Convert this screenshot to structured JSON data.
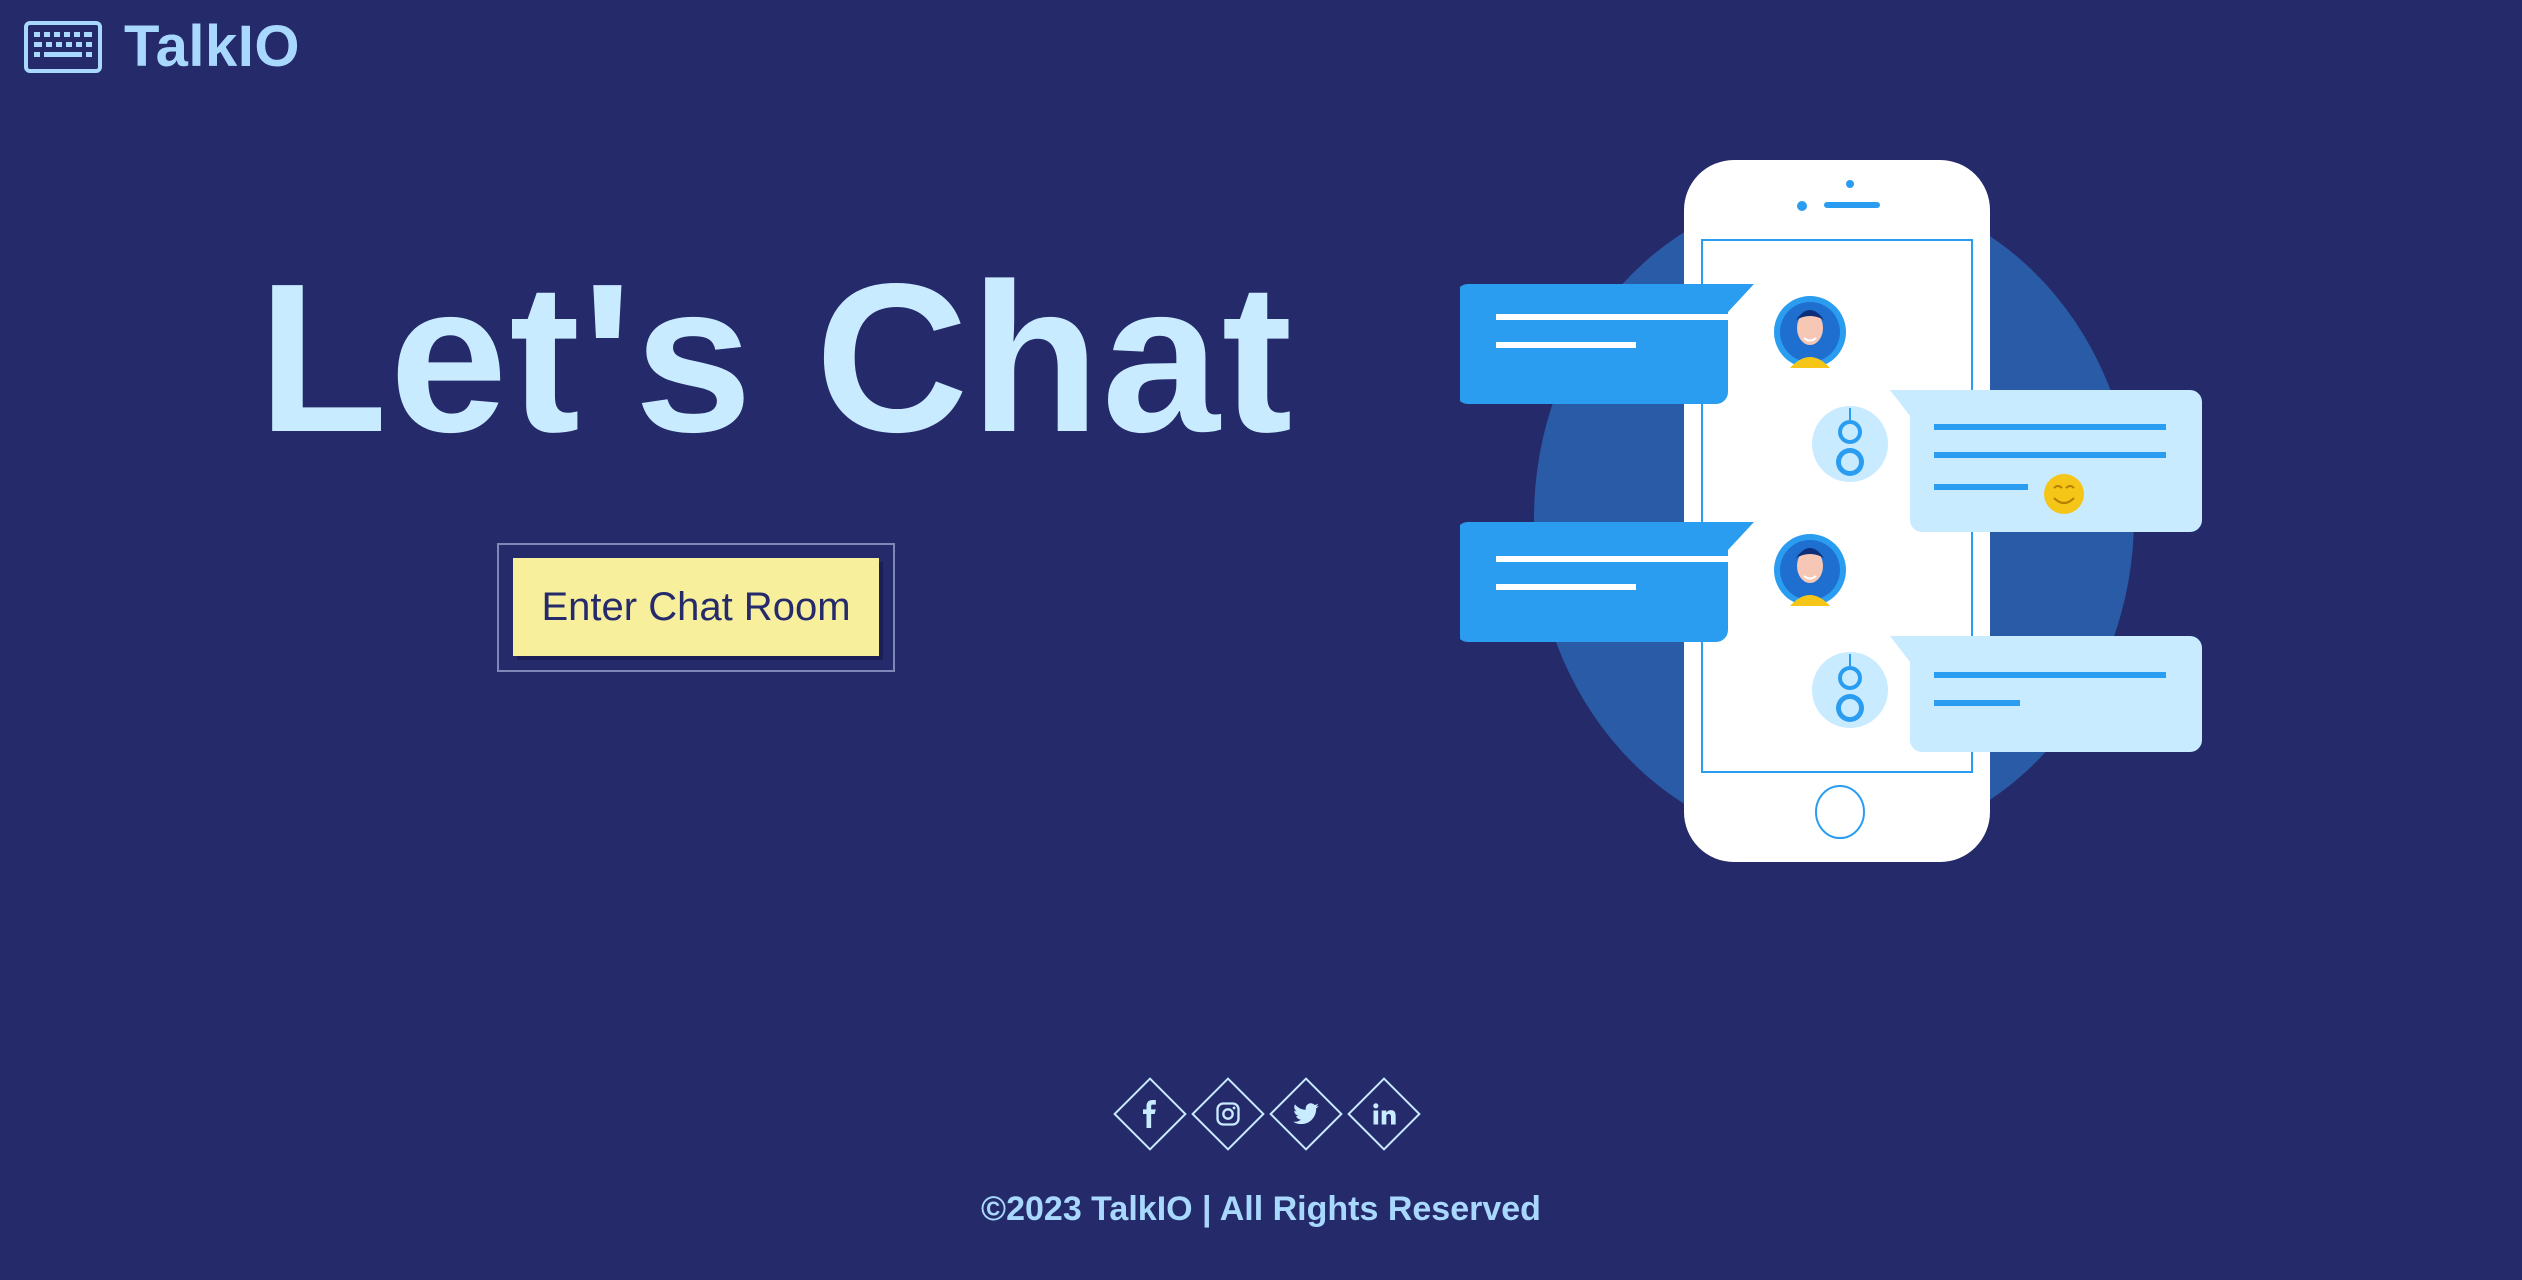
{
  "header": {
    "brand_name": "TalkIO",
    "brand_icon": "keyboard-icon"
  },
  "hero": {
    "title": "Let's Chat",
    "cta_label": "Enter Chat Room"
  },
  "illustration": {
    "name": "phone-chat-illustration"
  },
  "footer": {
    "social_links": [
      {
        "name": "facebook-icon"
      },
      {
        "name": "instagram-icon"
      },
      {
        "name": "twitter-icon"
      },
      {
        "name": "linkedin-icon"
      }
    ],
    "copyright": "©2023 TalkIO | All Rights Reserved"
  },
  "colors": {
    "background": "#252a6a",
    "accent_light": "#c9ebff",
    "brand": "#a9d8ff",
    "cta_bg": "#f8ef9d",
    "bubble_blue": "#2a9df0"
  }
}
